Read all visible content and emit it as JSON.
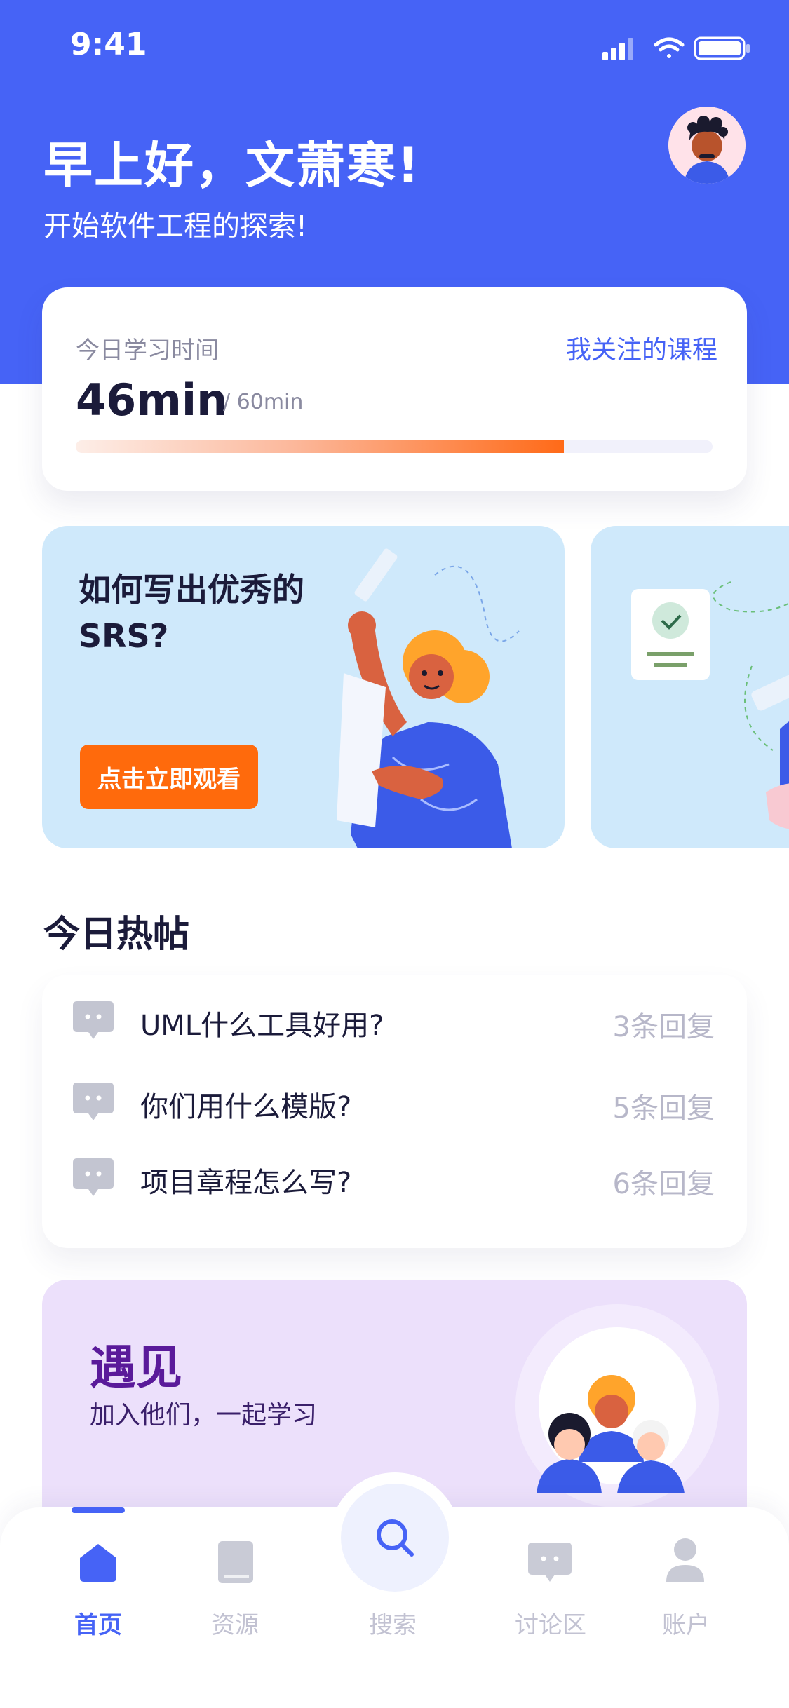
{
  "status_bar": {
    "time": "9:41"
  },
  "header": {
    "greeting": "早上好，文萧寒!",
    "subtitle": "开始软件工程的探索!"
  },
  "study": {
    "label": "今日学习时间",
    "link": "我关注的课程",
    "minutes": "46min",
    "total": "/ 60min",
    "progress_fraction": 0.767
  },
  "promo": {
    "title": "如何写出优秀的SRS?",
    "button": "点击立即观看"
  },
  "hot_posts": {
    "title": "今日热帖",
    "items": [
      {
        "title": "UML什么工具好用?",
        "replies": "3条回复"
      },
      {
        "title": "你们用什么模版?",
        "replies": "5条回复"
      },
      {
        "title": "项目章程怎么写?",
        "replies": "6条回复"
      }
    ]
  },
  "meet": {
    "title": "遇见",
    "subtitle": "加入他们，一起学习"
  },
  "nav": {
    "items": [
      {
        "label": "首页",
        "icon": "home-icon",
        "active": true
      },
      {
        "label": "资源",
        "icon": "book-icon",
        "active": false
      },
      {
        "label": "搜索",
        "icon": "search-icon",
        "active": false
      },
      {
        "label": "讨论区",
        "icon": "chat-icon",
        "active": false
      },
      {
        "label": "账户",
        "icon": "user-icon",
        "active": false
      }
    ]
  },
  "colors": {
    "primary": "#4663f6",
    "accent": "#ff6a0c",
    "inactive": "#c2c2d2"
  }
}
